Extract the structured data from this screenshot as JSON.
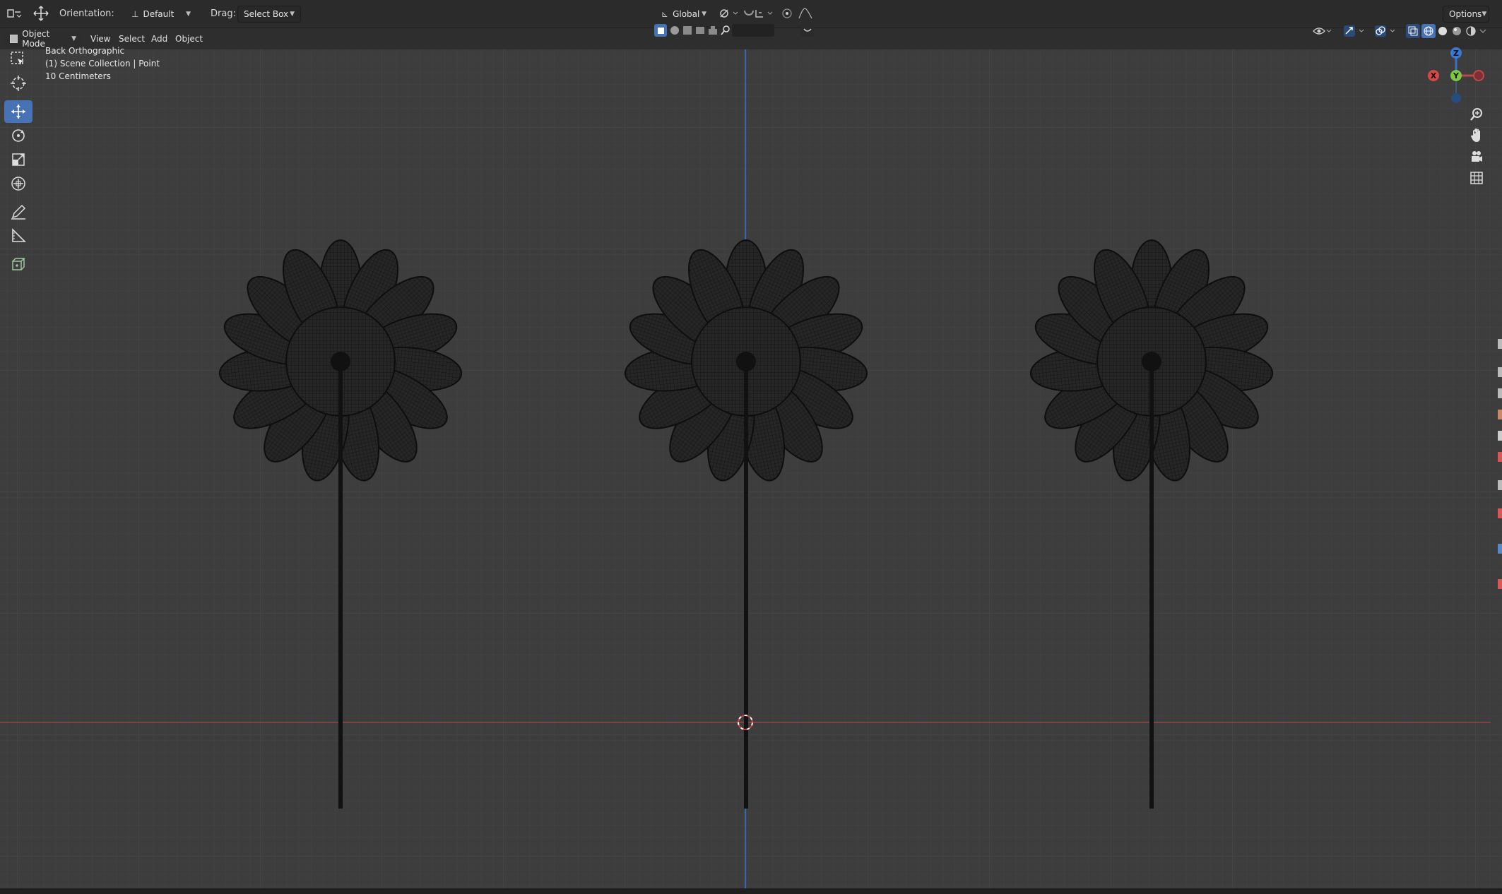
{
  "header": {
    "orientation_label": "Orientation:",
    "orientation_value": "Default",
    "drag_label": "Drag:",
    "drag_value": "Select Box",
    "transform_orientation": "Global",
    "options_label": "Options"
  },
  "menubar": {
    "mode": "Object Mode",
    "view": "View",
    "select": "Select",
    "add": "Add",
    "object": "Object"
  },
  "viewport": {
    "view_name": "Back Orthographic",
    "collection": "(1) Scene Collection | Point",
    "scale": "10 Centimeters"
  },
  "gizmo": {
    "z": "Z",
    "y": "Y",
    "x": "X"
  },
  "icons": {
    "toolbar": [
      "select-box-icon",
      "cursor-icon",
      "move-icon",
      "rotate-icon",
      "scale-icon",
      "transform-icon",
      "annotate-icon",
      "measure-icon",
      "add-cube-icon"
    ],
    "nav": [
      "zoom-icon",
      "pan-hand-icon",
      "camera-icon",
      "grid-view-icon"
    ]
  },
  "colors": {
    "viewport_bg": "#3d3d3d",
    "grid": "#474747",
    "axis_x": "#9c4040",
    "axis_z": "#3a66b0",
    "active_tool": "#4772b3",
    "flower": "#232323"
  }
}
